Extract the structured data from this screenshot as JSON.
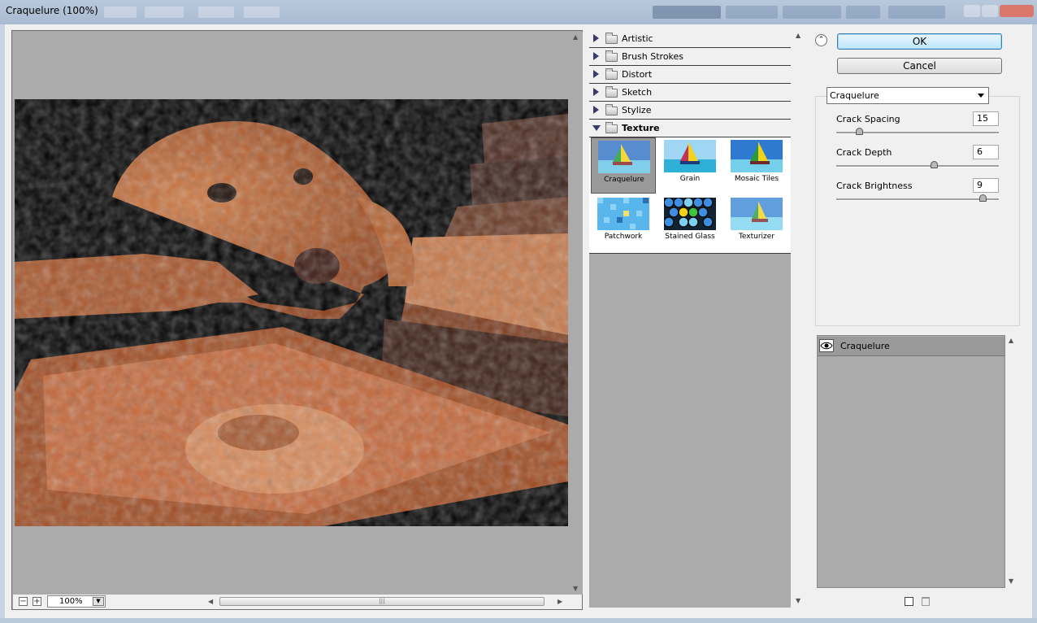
{
  "window": {
    "title": "Craquelure (100%)"
  },
  "preview": {
    "zoom_value": "100%",
    "zoom_out": "−",
    "zoom_in": "+"
  },
  "gallery": {
    "categories": [
      {
        "label": "Artistic",
        "expanded": false
      },
      {
        "label": "Brush Strokes",
        "expanded": false
      },
      {
        "label": "Distort",
        "expanded": false
      },
      {
        "label": "Sketch",
        "expanded": false
      },
      {
        "label": "Stylize",
        "expanded": false
      },
      {
        "label": "Texture",
        "expanded": true
      }
    ],
    "thumbs": [
      {
        "label": "Craquelure",
        "selected": true
      },
      {
        "label": "Grain",
        "selected": false
      },
      {
        "label": "Mosaic Tiles",
        "selected": false
      },
      {
        "label": "Patchwork",
        "selected": false
      },
      {
        "label": "Stained Glass",
        "selected": false
      },
      {
        "label": "Texturizer",
        "selected": false
      }
    ]
  },
  "buttons": {
    "ok": "OK",
    "cancel": "Cancel"
  },
  "settings": {
    "filter": "Craquelure",
    "params": [
      {
        "label": "Crack Spacing",
        "value": "15",
        "level": 0.14
      },
      {
        "label": "Crack Depth",
        "value": "6",
        "level": 0.6
      },
      {
        "label": "Crack Brightness",
        "value": "9",
        "level": 0.9
      }
    ]
  },
  "layers": {
    "items": [
      {
        "label": "Craquelure"
      }
    ]
  },
  "colors": {
    "ok_accent": "#3c7fb1",
    "image_tone": "#b3592a"
  }
}
